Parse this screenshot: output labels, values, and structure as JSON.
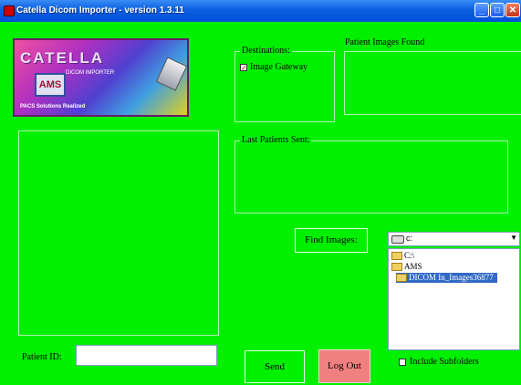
{
  "window": {
    "title": "Catella Dicom Importer - version 1.3.11",
    "minimize": "_",
    "maximize": "□",
    "close": "✕"
  },
  "logo": {
    "wordmark": "CATELLA",
    "subtitle": "DICOM IMPORTER",
    "box_text": "AMS",
    "tagline": "PACS Solutions Realized"
  },
  "destinations": {
    "label": "Destinations:",
    "items": [
      {
        "label": "Image Gateway",
        "checked": true
      }
    ]
  },
  "patient_images": {
    "label": "Patient Images Found"
  },
  "last_patients": {
    "label": "Last Patients Sent:"
  },
  "patient_id": {
    "label": "Patient ID:",
    "value": ""
  },
  "buttons": {
    "find_images": "Find Images:",
    "send": "Send",
    "log_out": "Log Out"
  },
  "drive": {
    "value": "c:",
    "arrow": "▼"
  },
  "directories": [
    {
      "label": "C:\\",
      "selected": false
    },
    {
      "label": "AMS",
      "selected": false
    },
    {
      "label": "DICOM In_Images36877",
      "selected": true
    }
  ],
  "include_subfolders": {
    "label": "Include Subfolders",
    "checked": false
  },
  "colors": {
    "background": "#00f000",
    "logout": "#f08080",
    "titlebar": "#0a5fe0",
    "selection": "#316ac5"
  }
}
